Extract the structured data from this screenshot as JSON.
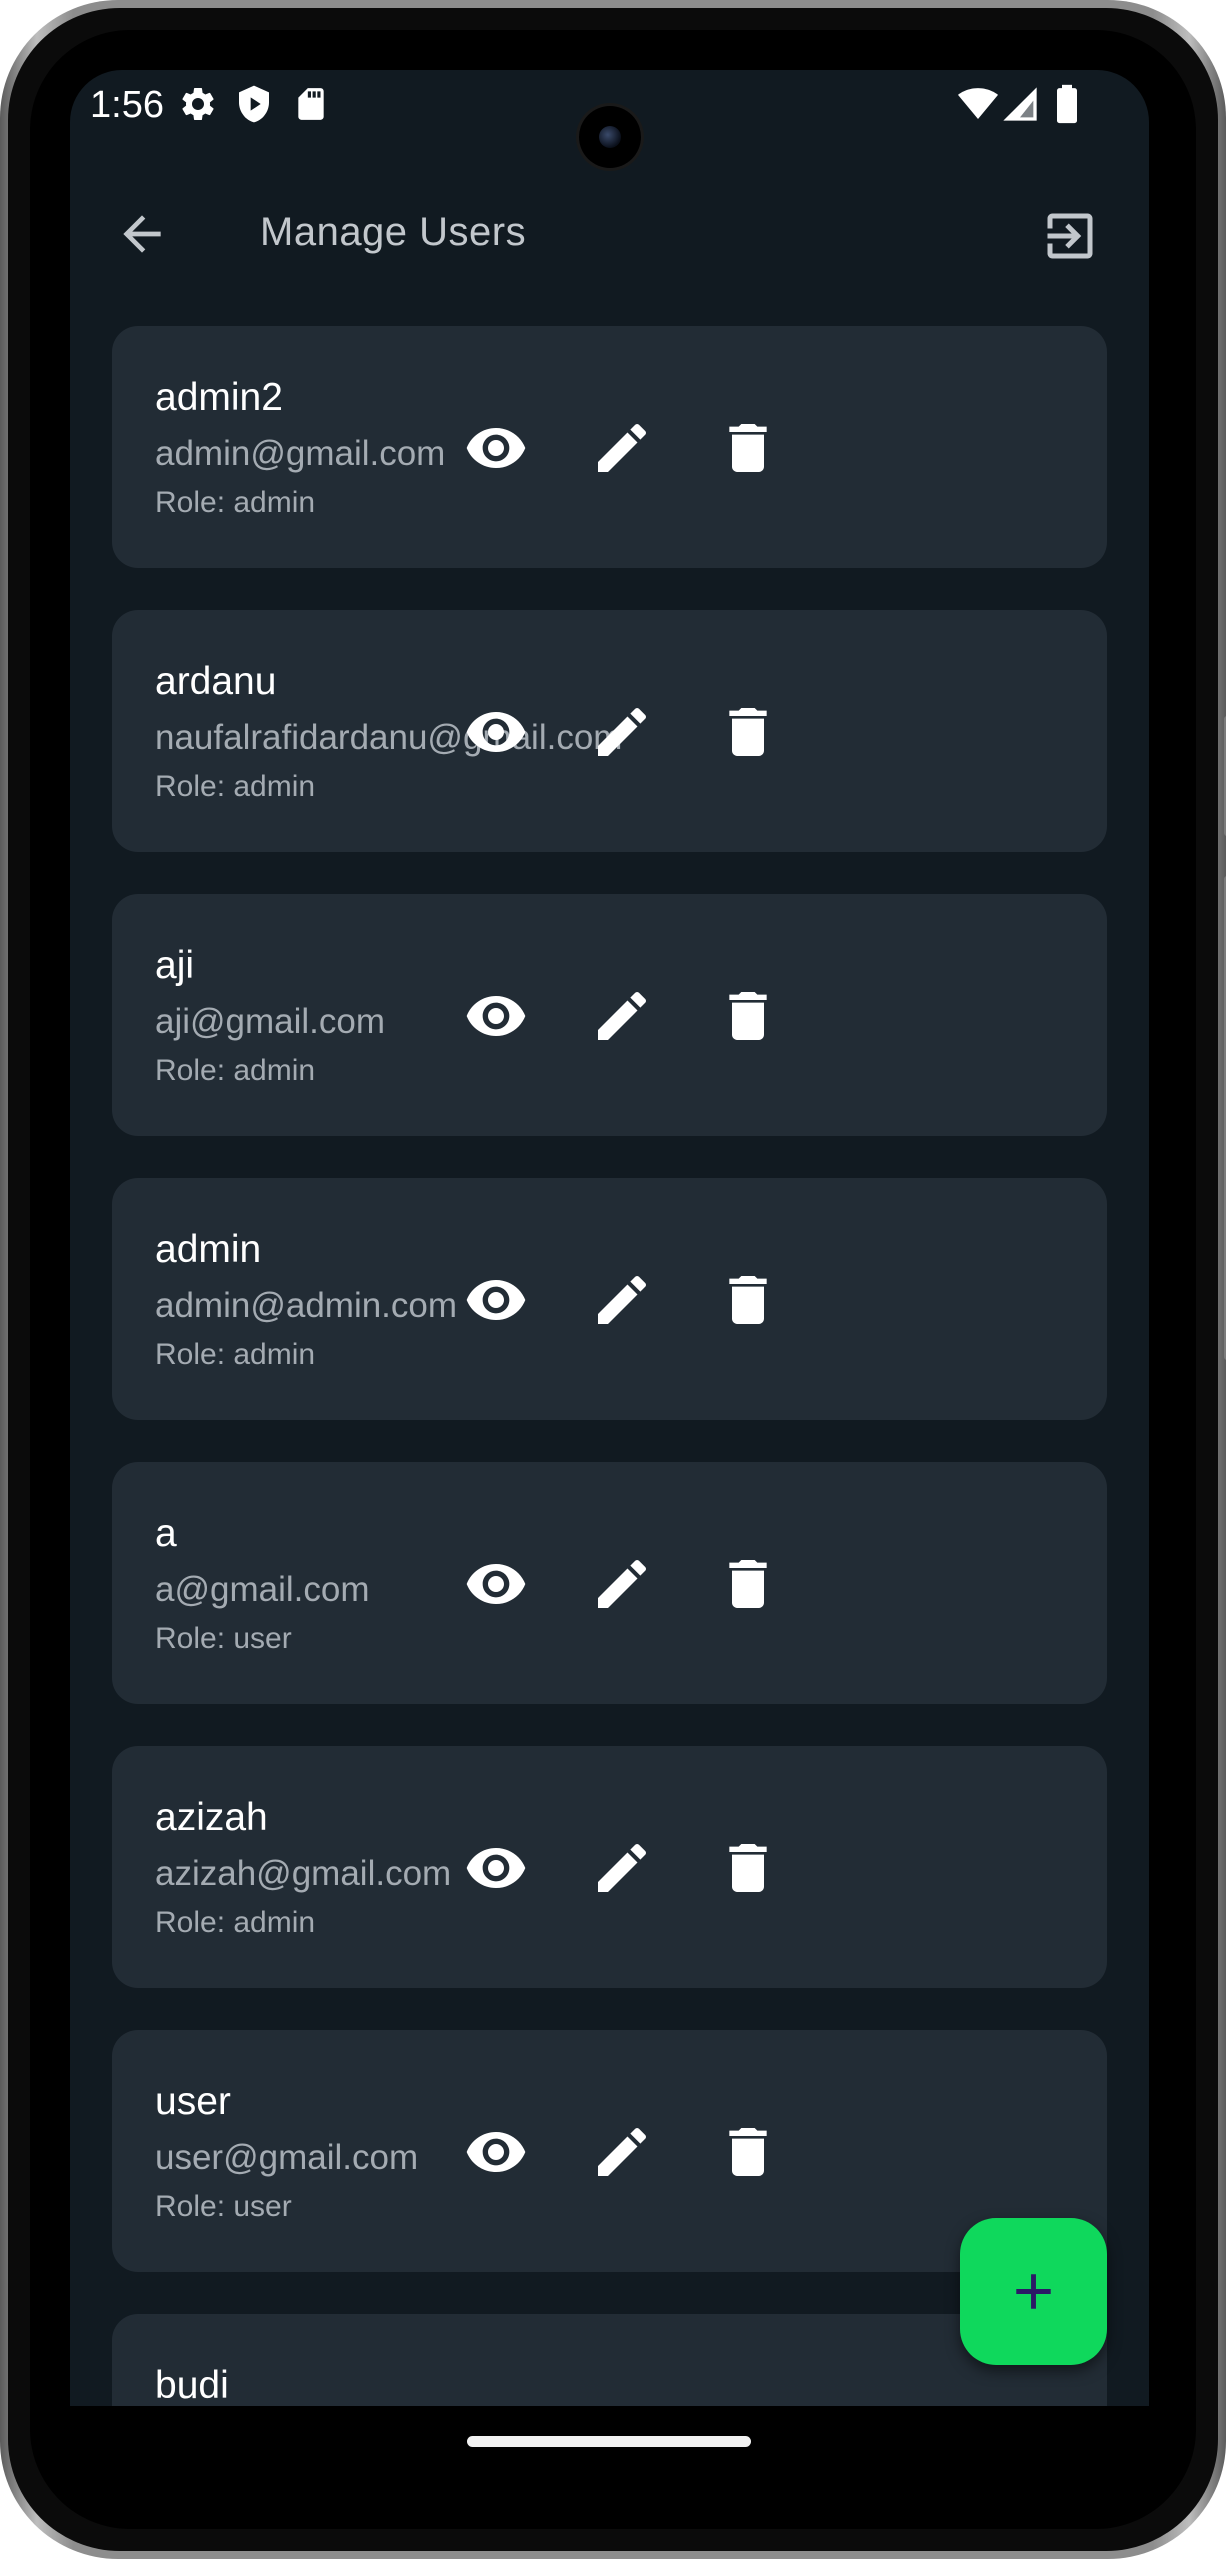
{
  "status_bar": {
    "time": "1:56",
    "left_icons": [
      "settings-icon",
      "shield-play-icon",
      "sd-card-icon"
    ],
    "right_icons": [
      "wifi-icon",
      "cellular-signal-icon",
      "battery-icon"
    ]
  },
  "app_bar": {
    "title": "Manage Users",
    "back_icon": "arrow-back-icon",
    "logout_icon": "logout-icon"
  },
  "colors": {
    "background": "#111a21",
    "card": "#222c35",
    "fab": "#0fd85c",
    "fab_icon": "#2b1a66",
    "primary_text": "#ffffff",
    "secondary_text": "#a4abb2"
  },
  "users": [
    {
      "name": "admin2",
      "email": "admin@gmail.com",
      "role": "Role: admin"
    },
    {
      "name": "ardanu",
      "email": "naufalrafidardanu@gmail.com",
      "role": "Role: admin"
    },
    {
      "name": "aji",
      "email": "aji@gmail.com",
      "role": "Role: admin"
    },
    {
      "name": "admin",
      "email": "admin@admin.com",
      "role": "Role: admin"
    },
    {
      "name": "a",
      "email": "a@gmail.com",
      "role": "Role: user"
    },
    {
      "name": "azizah",
      "email": "azizah@gmail.com",
      "role": "Role: admin"
    },
    {
      "name": "user",
      "email": "user@gmail.com",
      "role": "Role: user"
    },
    {
      "name": "budi",
      "email": "",
      "role": ""
    }
  ],
  "user_actions": [
    "eye-icon",
    "pencil-icon",
    "trash-icon"
  ],
  "fab": {
    "icon": "plus-icon"
  }
}
